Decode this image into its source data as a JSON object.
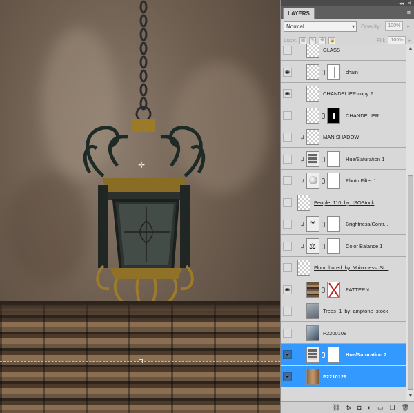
{
  "panel": {
    "tab_title": "LAYERS",
    "tab_menu_icon": "panel-menu-icon",
    "blend_mode": "Normal",
    "opacity_label": "Opacity:",
    "opacity_value": "100%",
    "lock_label": "Lock:",
    "fill_label": "Fill:",
    "fill_value": "100%"
  },
  "layers": [
    {
      "name": "GLASS",
      "visible": false,
      "thumb": "trans"
    },
    {
      "name": "chain",
      "visible": true,
      "thumb": "trans",
      "mask": "chain-mask"
    },
    {
      "name": "CHANDELIER copy 2",
      "visible": true,
      "thumb": "trans"
    },
    {
      "name": "CHANDELIER",
      "visible": false,
      "thumb": "trans",
      "mask": "black"
    },
    {
      "name": "MAN SHADOW",
      "visible": false,
      "thumb": "trans",
      "clipped": true
    },
    {
      "name": "Hue/Saturation 1",
      "visible": false,
      "thumb": "adj",
      "mask": "white",
      "clipped": true
    },
    {
      "name": "Photo Filter 1",
      "visible": false,
      "thumb": "pf",
      "mask": "white",
      "clipped": true
    },
    {
      "name": "People_110_by_ISOStock",
      "visible": false,
      "thumb": "trans",
      "underline": true
    },
    {
      "name": "Brightness/Contr...",
      "visible": false,
      "thumb": "bc",
      "mask": "white",
      "clipped": true
    },
    {
      "name": "Color Balance 1",
      "visible": false,
      "thumb": "cb",
      "mask": "white",
      "clipped": true
    },
    {
      "name": "Floor_bored_by_Voivodess_St...",
      "visible": false,
      "thumb": "trans",
      "underline": true
    },
    {
      "name": "PATTERN",
      "visible": true,
      "thumb": "pattern",
      "mask": "x"
    },
    {
      "name": "Trees_1_by_amptone_stock",
      "visible": false,
      "thumb": "trees"
    },
    {
      "name": "P2200108",
      "visible": false,
      "thumb": "photo"
    },
    {
      "name": "Hue/Saturation 2",
      "visible": true,
      "thumb": "adj",
      "mask": "white",
      "selected": true
    },
    {
      "name": "P2210129",
      "visible": true,
      "thumb": "p2210",
      "selected": true
    }
  ],
  "bottombar": {
    "icons": [
      "link-layers-icon",
      "fx-icon",
      "add-mask-icon",
      "adjustment-layer-icon",
      "new-group-icon",
      "new-layer-icon",
      "trash-icon"
    ],
    "glyphs": [
      "⛓",
      "fx",
      "◘",
      "◐",
      "▭",
      "❏",
      "🗑"
    ]
  }
}
